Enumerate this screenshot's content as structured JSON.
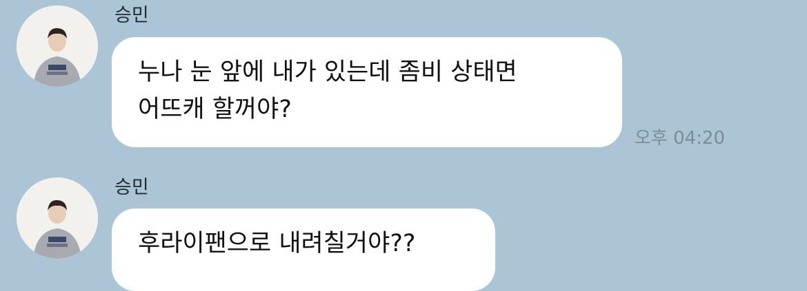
{
  "chat": {
    "messages": [
      {
        "sender": "승민",
        "lines": [
          "누나 눈 앞에 내가 있는데 좀비 상태면",
          "어뜨캐 할꺼야?"
        ],
        "time": "오후 04:20",
        "avatar_icon": "profile-photo"
      },
      {
        "sender": "승민",
        "lines": [
          "후라이팬으로 내려칠거야??"
        ],
        "time": "",
        "avatar_icon": "profile-photo"
      }
    ]
  },
  "colors": {
    "background": "#abc5d6",
    "bubble": "#ffffff",
    "time_text": "#7c8c98"
  }
}
